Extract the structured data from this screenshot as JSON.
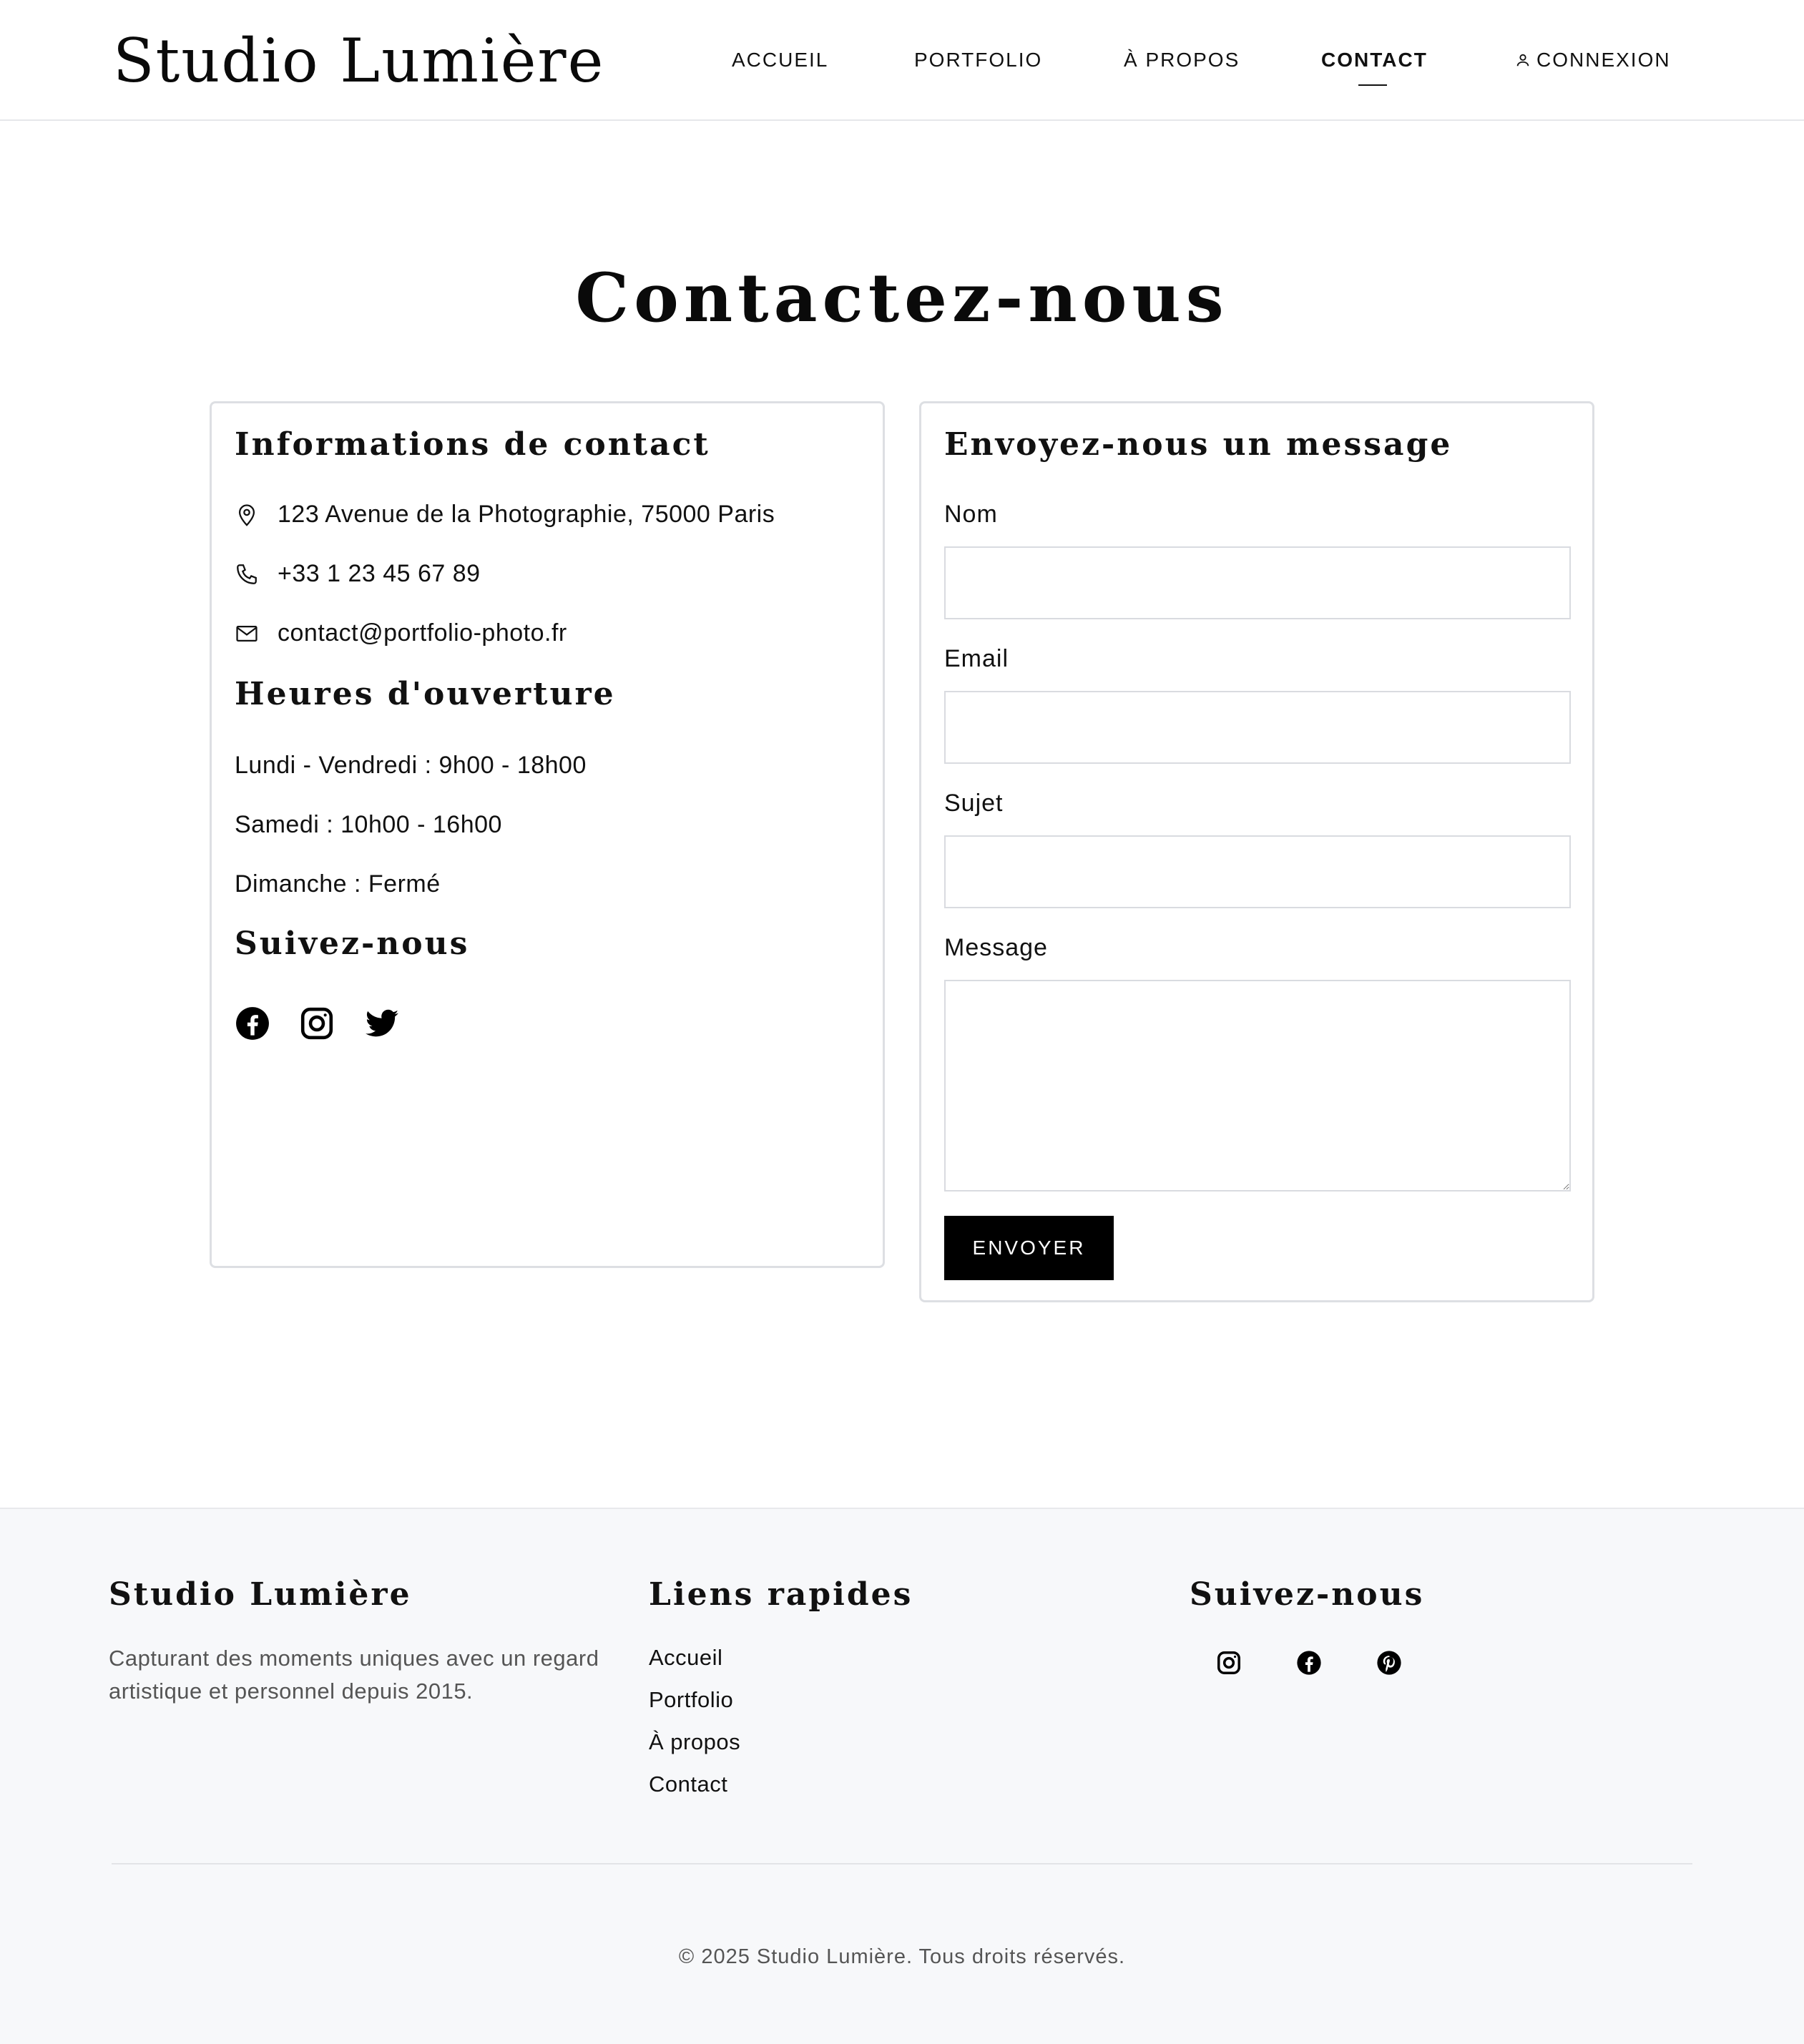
{
  "header": {
    "logo": "Studio Lumière",
    "nav": [
      {
        "label": "ACCUEIL"
      },
      {
        "label": "PORTFOLIO"
      },
      {
        "label": "À PROPOS"
      },
      {
        "label": "CONTACT",
        "active": true
      },
      {
        "label": "CONNEXION",
        "icon": "user-icon"
      }
    ]
  },
  "main": {
    "title": "Contactez-nous",
    "info": {
      "heading": "Informations de contact",
      "address": "123 Avenue de la Photographie, 75000 Paris",
      "phone": "+33 1 23 45 67 89",
      "email": "contact@portfolio-photo.fr",
      "icons": [
        "map-pin-icon",
        "phone-icon",
        "mail-icon"
      ],
      "hours_heading": "Heures d'ouverture",
      "hours": [
        "Lundi - Vendredi : 9h00 - 18h00",
        "Samedi : 10h00 - 16h00",
        "Dimanche : Fermé"
      ],
      "social_heading": "Suivez-nous",
      "social_icons": [
        "facebook-icon",
        "instagram-icon",
        "twitter-icon"
      ]
    },
    "form": {
      "heading": "Envoyez-nous un message",
      "fields": [
        {
          "label": "Nom",
          "value": ""
        },
        {
          "label": "Email",
          "value": ""
        },
        {
          "label": "Sujet",
          "value": ""
        },
        {
          "label": "Message",
          "value": ""
        }
      ],
      "submit_label": "ENVOYER"
    }
  },
  "footer": {
    "brand_heading": "Studio Lumière",
    "brand_description": "Capturant des moments uniques avec un regard artistique et personnel depuis 2015.",
    "links_heading": "Liens rapides",
    "links": [
      "Accueil",
      "Portfolio",
      "À propos",
      "Contact"
    ],
    "social_heading": "Suivez-nous",
    "social_icons": [
      "instagram-icon",
      "facebook-icon",
      "pinterest-icon"
    ],
    "copyright": "© 2025 Studio Lumière. Tous droits réservés."
  },
  "colors": {
    "text": "#111111",
    "button_bg": "#000000",
    "button_text": "#ffffff",
    "border": "#dddfe3",
    "footer_bg": "#f7f8fa",
    "muted_text": "#555555"
  }
}
